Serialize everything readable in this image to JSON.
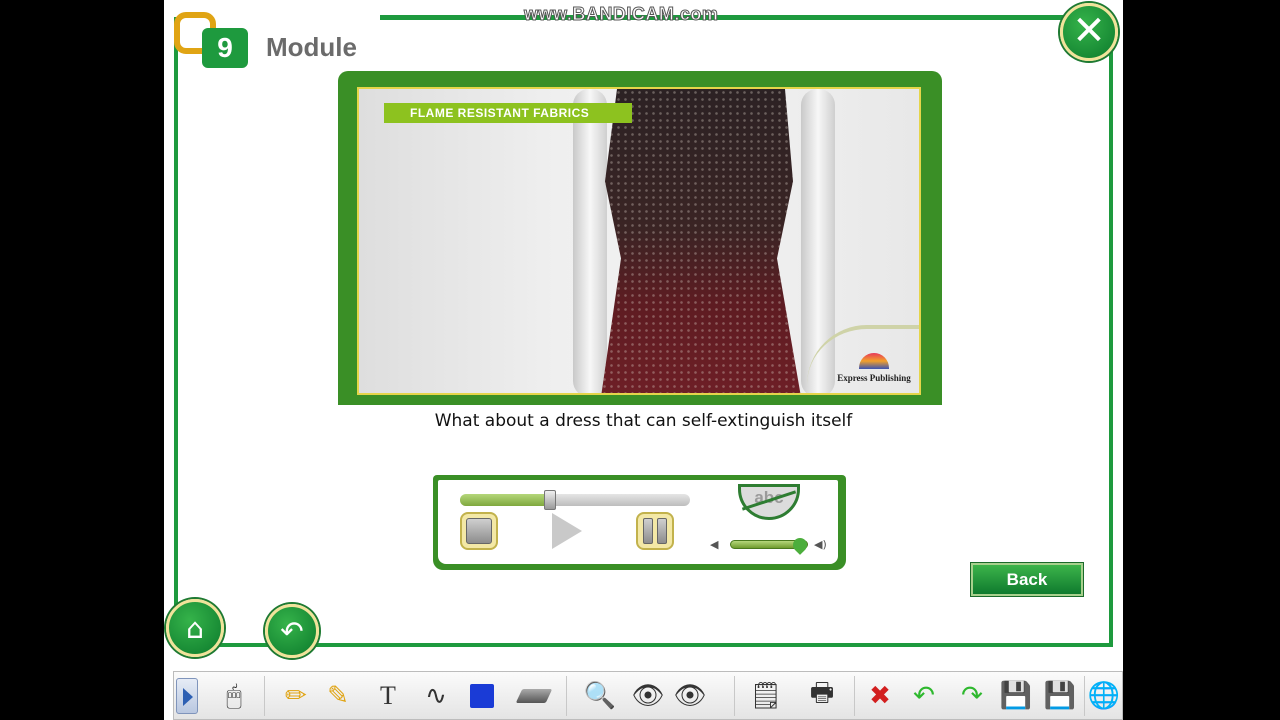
{
  "watermark": "www.BANDICAM.com",
  "module": {
    "number": "9",
    "title": "Module"
  },
  "video": {
    "banner": "FLAME RESISTANT FABRICS",
    "publisher": "Express Publishing"
  },
  "caption": "What about a dress that can self-extinguish itself",
  "player": {
    "progress": 0.39,
    "volume": 0.88,
    "subtitles_label": "abc"
  },
  "back_button": "Back",
  "icons": {
    "close": "close-icon",
    "home": "home-icon",
    "undo": "undo-icon",
    "toolbar": [
      "expand-arrow-icon",
      "mouse-icon",
      "pencil-icon",
      "highlighter-icon",
      "text-tool-icon",
      "curve-tool-icon",
      "shape-icon",
      "eraser-icon",
      "magnifier-icon",
      "spotlight-icon",
      "reveal-icon",
      "blank-page-icon",
      "print-icon",
      "clear-icon",
      "undo-green-icon",
      "redo-green-icon",
      "save-icon",
      "save-as-icon",
      "globe-icon"
    ]
  },
  "colors": {
    "accent_green": "#1e9a3e",
    "banner_green": "#8dc21f",
    "module_orange": "#e0a414"
  }
}
